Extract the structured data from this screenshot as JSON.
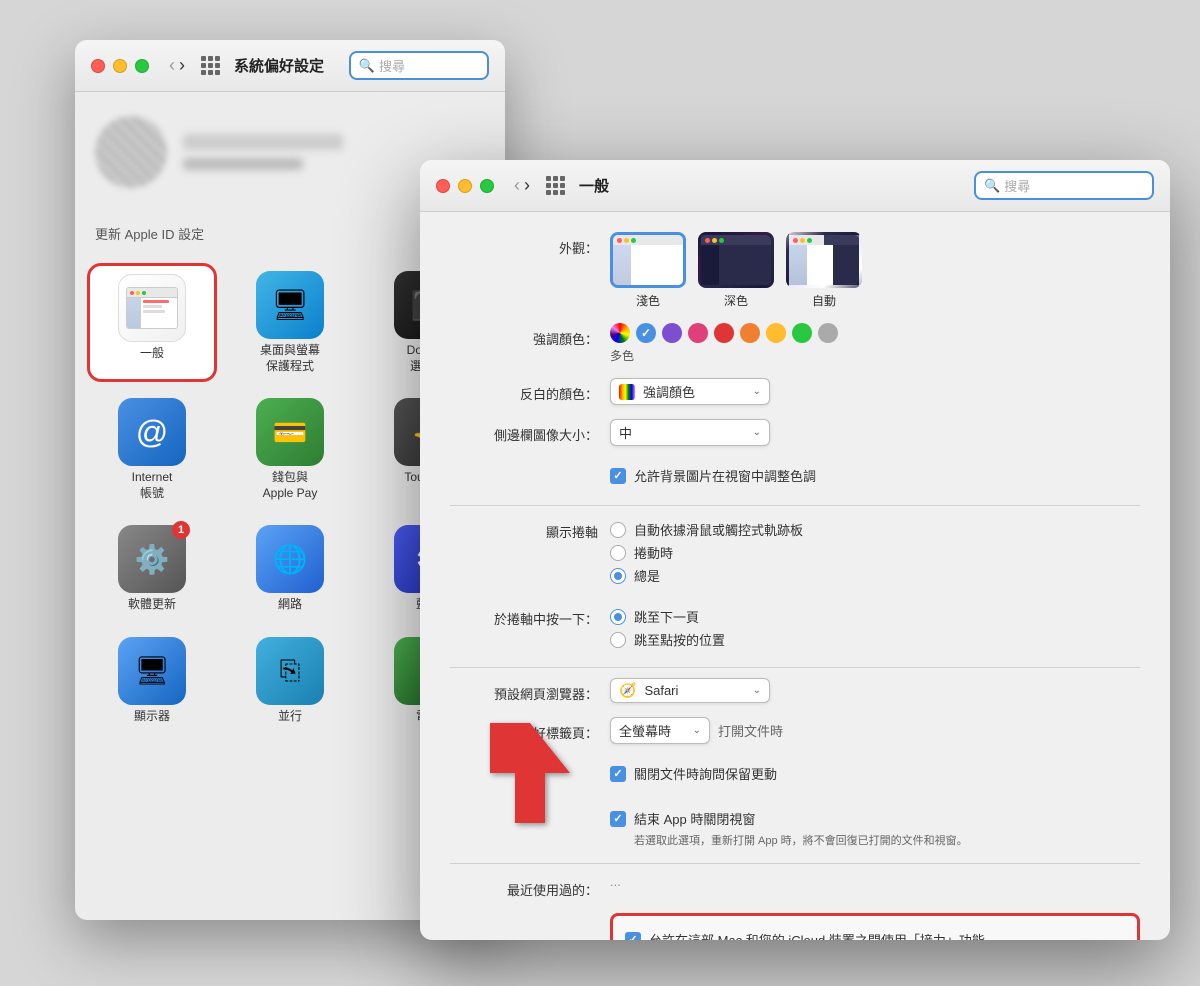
{
  "colors": {
    "accent_blue": "#4a90e2",
    "accent_red": "#e03535",
    "traffic_red": "#ff5f57",
    "traffic_yellow": "#febc2e",
    "traffic_green": "#28c840"
  },
  "back_window": {
    "title": "系統偏好設定",
    "search_placeholder": "搜尋",
    "update_apple_id": "更新 Apple ID 設定",
    "icons": [
      {
        "id": "general",
        "label": "一般",
        "selected": true
      },
      {
        "id": "desktop",
        "label": "桌面與螢幕\n保護程式",
        "selected": false
      },
      {
        "id": "dock",
        "label": "Dock 與\n選單列",
        "selected": false
      },
      {
        "id": "internet",
        "label": "Internet\n帳號",
        "selected": false
      },
      {
        "id": "wallet",
        "label": "錢包與\nApple Pay",
        "selected": false
      },
      {
        "id": "touchid",
        "label": "Touch ID",
        "selected": false
      },
      {
        "id": "software",
        "label": "軟體更新",
        "selected": false,
        "badge": "1"
      },
      {
        "id": "network",
        "label": "網路",
        "selected": false
      },
      {
        "id": "bluetooth",
        "label": "藍牙",
        "selected": false
      },
      {
        "id": "display",
        "label": "顯示器",
        "selected": false
      },
      {
        "id": "sidebar",
        "label": "並行",
        "selected": false
      },
      {
        "id": "battery",
        "label": "電池",
        "selected": false
      }
    ]
  },
  "front_window": {
    "title": "一般",
    "search_placeholder": "搜尋",
    "sections": {
      "appearance_label": "外觀：",
      "appearance_options": [
        {
          "id": "light",
          "label": "淺色",
          "selected": true
        },
        {
          "id": "dark",
          "label": "深色",
          "selected": false
        },
        {
          "id": "auto",
          "label": "自動",
          "selected": false
        }
      ],
      "accent_color_label": "強調顏色：",
      "accent_colors": [
        {
          "color": "#ff5f8a",
          "name": "pink"
        },
        {
          "color": "#4a90e2",
          "name": "blue",
          "selected": true
        },
        {
          "color": "#7b4fcf",
          "name": "purple"
        },
        {
          "color": "#e0407a",
          "name": "rose"
        },
        {
          "color": "#e03535",
          "name": "red"
        },
        {
          "color": "#f08030",
          "name": "orange"
        },
        {
          "color": "#febc2e",
          "name": "yellow"
        },
        {
          "color": "#28c840",
          "name": "green"
        },
        {
          "color": "#aaaaaa",
          "name": "graphite"
        }
      ],
      "accent_multi_label": "多色",
      "highlight_color_label": "反白的顏色：",
      "highlight_color_value": "強調顏色",
      "sidebar_size_label": "側邊欄圖像大小：",
      "sidebar_size_value": "中",
      "allow_wallpaper_label": "允許背景圖片在視窗中調整色調",
      "scroll_indicator_label": "顯示捲軸",
      "scroll_options": [
        {
          "label": "自動依據滑鼠或觸控式軌跡板",
          "selected": false
        },
        {
          "label": "捲動時",
          "selected": false
        },
        {
          "label": "總是",
          "selected": true
        }
      ],
      "scroll_click_label": "於捲軸中按一下：",
      "scroll_click_options": [
        {
          "label": "跳至下一頁",
          "selected": true
        },
        {
          "label": "跳至點按的位置",
          "selected": false
        }
      ],
      "browser_label": "預設網頁瀏覽器：",
      "browser_value": "Safari",
      "tabs_label": "好標籤頁：",
      "tabs_value": "全螢幕時",
      "tabs_action": "打開文件時",
      "close_save_label": "關閉文件時詢問保留更動",
      "quit_close_label": "結束 App 時關閉視窗",
      "quit_note": "若選取此選項，重新打開 App 時，將不會回復已打開的文件和視窗。",
      "recent_label": "最近使用過的：",
      "handoff_label": "允許在這部 Mac 和您的 iCloud 裝置之間使用「接力」功能"
    }
  }
}
